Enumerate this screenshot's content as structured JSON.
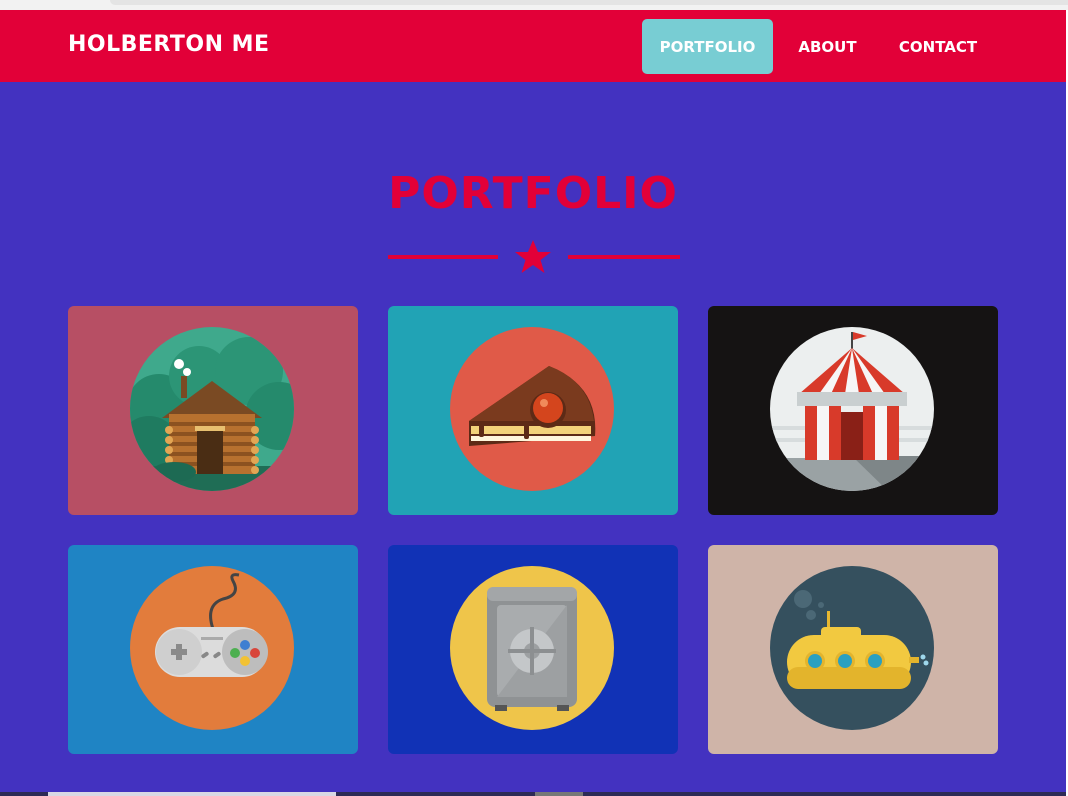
{
  "brand": "HOLBERTON ME",
  "nav": {
    "items": [
      {
        "label": "PORTFOLIO",
        "active": true
      },
      {
        "label": "ABOUT",
        "active": false
      },
      {
        "label": "CONTACT",
        "active": false
      }
    ]
  },
  "section": {
    "title": "PORTFOLIO"
  },
  "colors": {
    "navbar": "#e20038",
    "page_background": "#4332c0",
    "active_tab": "#78cdd3",
    "accent": "#e20038"
  },
  "portfolio": [
    {
      "icon": "log-cabin-icon",
      "card_color": "#b74f64"
    },
    {
      "icon": "cake-slice-icon",
      "card_color": "#21a3b5"
    },
    {
      "icon": "circus-tent-icon",
      "card_color": "#151313"
    },
    {
      "icon": "game-controller-icon",
      "card_color": "#1f84c4"
    },
    {
      "icon": "safe-icon",
      "card_color": "#1132b6"
    },
    {
      "icon": "submarine-icon",
      "card_color": "#cfb4a8"
    }
  ]
}
